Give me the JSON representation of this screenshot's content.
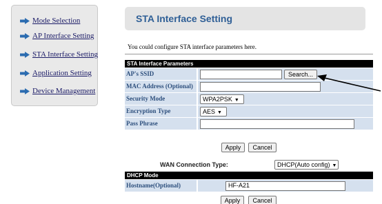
{
  "sidebar": {
    "items": [
      {
        "label": "Mode Selection"
      },
      {
        "label": "AP Interface Setting"
      },
      {
        "label": "STA Interface Setting"
      },
      {
        "label": "Application Setting"
      },
      {
        "label": "Device Management"
      }
    ]
  },
  "header": {
    "title": "STA Interface Setting"
  },
  "intro": "You could configure STA interface parameters here.",
  "sta_section": {
    "title": "STA Interface Parameters",
    "ssid": {
      "label": "AP's SSID",
      "value": "",
      "search_button": "Search..."
    },
    "mac": {
      "label": "MAC Address (Optional)",
      "value": ""
    },
    "security": {
      "label": "Security Mode",
      "selected": "WPA2PSK"
    },
    "encryption": {
      "label": "Encryption Type",
      "selected": "AES"
    },
    "passphrase": {
      "label": "Pass Phrase",
      "value": ""
    }
  },
  "sta_buttons": {
    "apply": "Apply",
    "cancel": "Cancel"
  },
  "wan": {
    "label": "WAN Connection Type:",
    "selected": "DHCP(Auto config)"
  },
  "dhcp_section": {
    "title": "DHCP Mode",
    "hostname": {
      "label": "Hostname(Optional)",
      "value": "HF-A21"
    }
  },
  "dhcp_buttons": {
    "apply": "Apply",
    "cancel": "Cancel"
  },
  "colors": {
    "accent": "#2f5f96",
    "label_bg": "#d5e0ee",
    "section_bg": "#000000",
    "arrow": "#2b6cb0"
  },
  "icons": {
    "nav": "right-arrow-icon",
    "dropdown": "chevron-down-icon"
  }
}
